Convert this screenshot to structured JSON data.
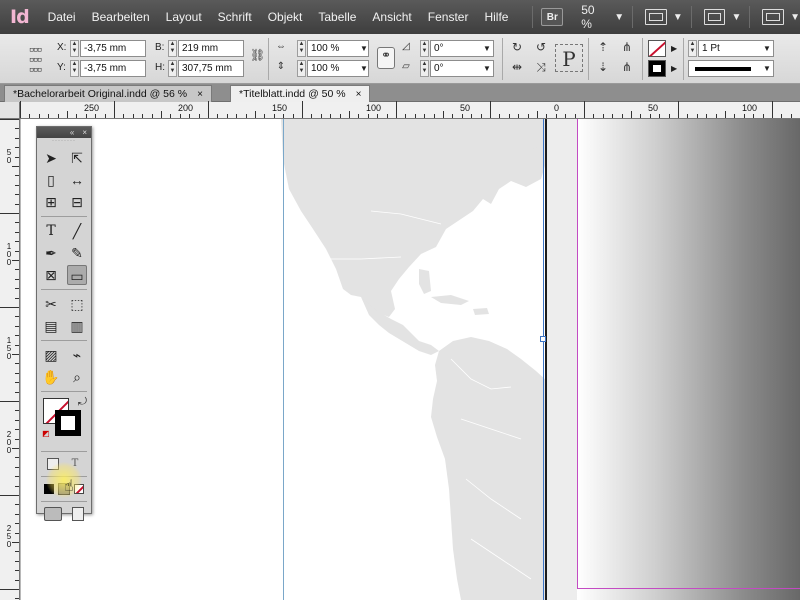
{
  "app": {
    "logo": "Id"
  },
  "menu": [
    "Datei",
    "Bearbeiten",
    "Layout",
    "Schrift",
    "Objekt",
    "Tabelle",
    "Ansicht",
    "Fenster",
    "Hilfe"
  ],
  "menubar": {
    "bridge": "Br",
    "zoom": "50 %"
  },
  "control": {
    "x_label": "X:",
    "x_value": "-3,75 mm",
    "y_label": "Y:",
    "y_value": "-3,75 mm",
    "w_label": "B:",
    "w_value": "219 mm",
    "h_label": "H:",
    "h_value": "307,75 mm",
    "scale_x": "100 %",
    "scale_y": "100 %",
    "rotate": "0°",
    "shear": "0°",
    "stroke_weight": "1 Pt"
  },
  "tabs": [
    {
      "label": "*Bachelorarbeit Original.indd @ 56 %",
      "close": "×",
      "active": false
    },
    {
      "label": "*Titelblatt.indd @ 50 %",
      "close": "×",
      "active": true
    }
  ],
  "ruler_top": [
    "250",
    "200",
    "150",
    "100",
    "50",
    "0",
    "50",
    "100"
  ],
  "ruler_left": [
    {
      "digits": [
        "5",
        "0"
      ]
    },
    {
      "digits": [
        "1",
        "0",
        "0"
      ]
    },
    {
      "digits": [
        "1",
        "5",
        "0"
      ]
    },
    {
      "digits": [
        "2",
        "0",
        "0"
      ]
    },
    {
      "digits": [
        "2",
        "5",
        "0"
      ]
    }
  ],
  "tools": {
    "header_collapse": "«",
    "header_close": "×",
    "grip": "········",
    "type_t": "T",
    "text_frame": "T"
  },
  "colors": {
    "menubar": "#4a4a4a",
    "logo": "#f3b6d3",
    "map_land": "#e3e3e3",
    "guide": "#3b73c4",
    "margin": "#c34bc3",
    "none_swatch": "#c8102e"
  }
}
